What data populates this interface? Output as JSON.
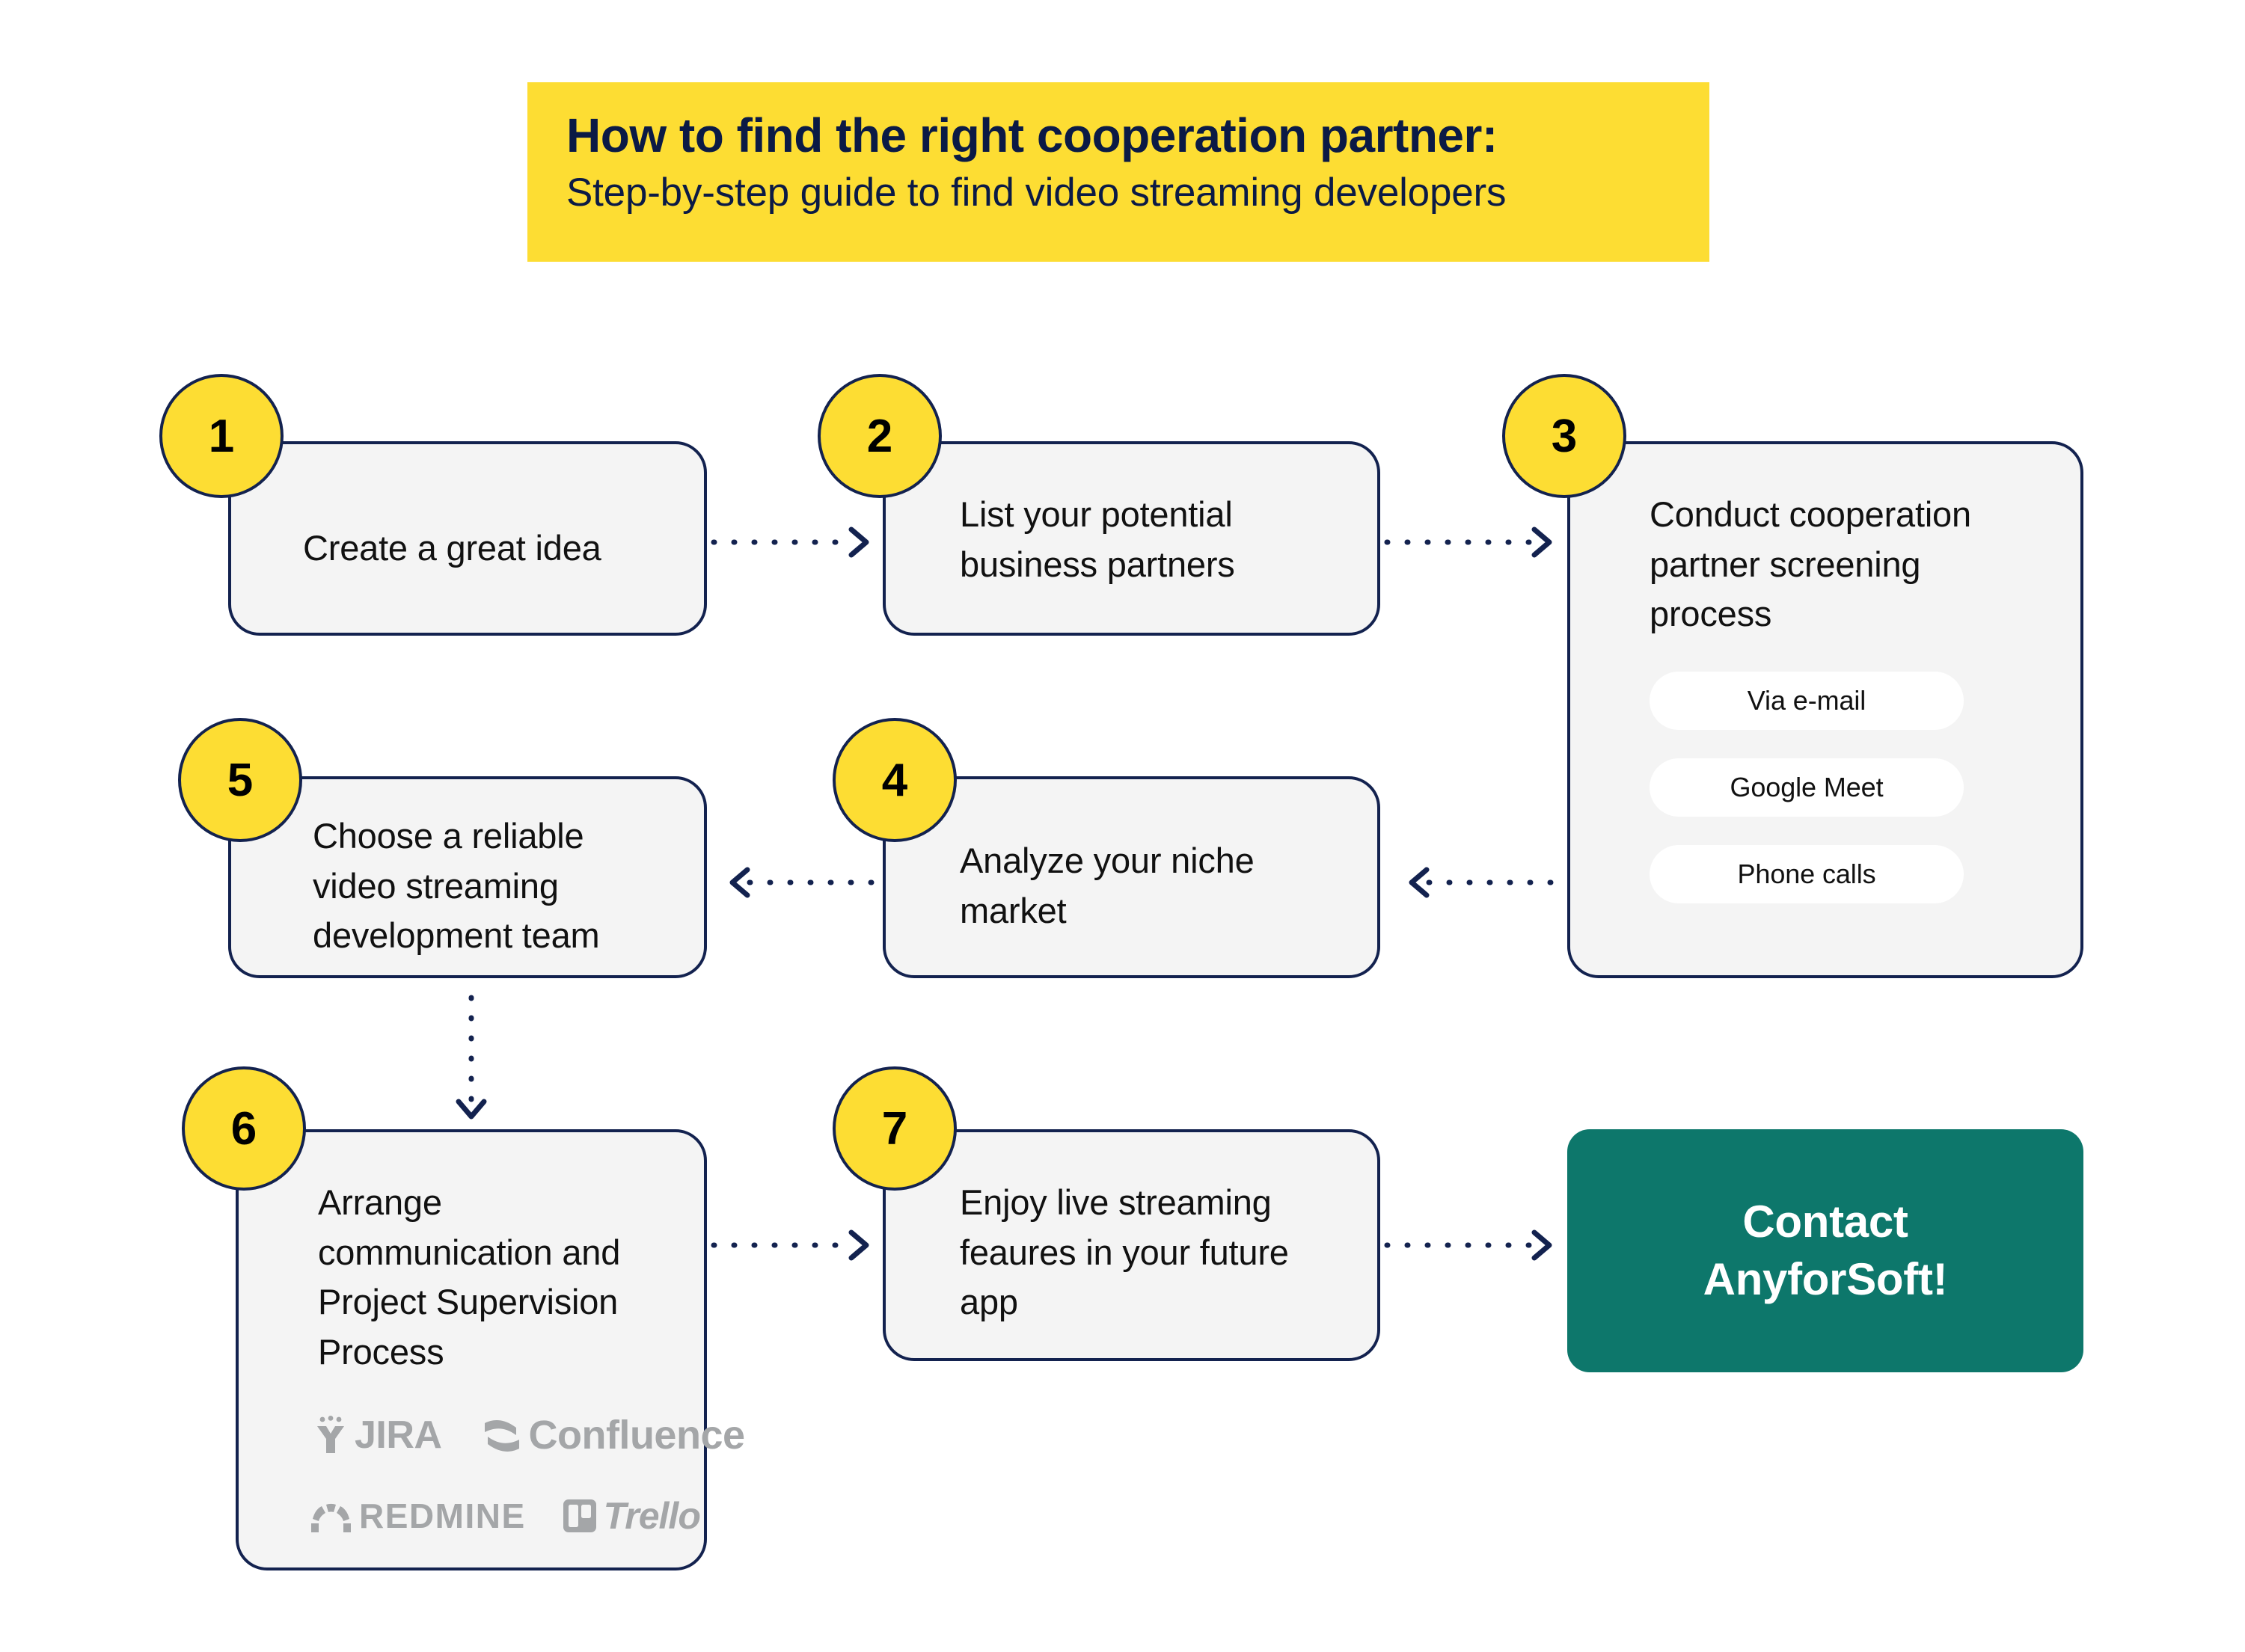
{
  "title": {
    "main": "How to find the right cooperation partner:",
    "sub": "Step-by-step guide to find video streaming developers"
  },
  "colors": {
    "yellow": "#FDDD33",
    "navy": "#13224F",
    "title_navy": "#0B1A45",
    "box_bg": "#F4F4F4",
    "teal": "#0D776B",
    "logo_grey": "#A4A6A8",
    "pill_bg": "#FFFFFF",
    "page_bg": "#FFFFFF"
  },
  "steps": [
    {
      "number": "1",
      "text": "Create a great idea"
    },
    {
      "number": "2",
      "text": "List your potential business partners"
    },
    {
      "number": "3",
      "text": "Conduct cooperation partner screening process"
    },
    {
      "number": "4",
      "text": "Analyze your niche market"
    },
    {
      "number": "5",
      "text": "Choose a reliable video streaming development team"
    },
    {
      "number": "6",
      "text": "Arrange communication and Project Supervision Process"
    },
    {
      "number": "7",
      "text": "Enjoy live streaming feaures in your future app"
    }
  ],
  "step3_options": [
    {
      "label": "Via e-mail"
    },
    {
      "label": "Google Meet"
    },
    {
      "label": "Phone calls"
    }
  ],
  "step6_tools": [
    {
      "name": "JIRA"
    },
    {
      "name": "Confluence"
    },
    {
      "name": "REDMINE"
    },
    {
      "name": "Trello"
    }
  ],
  "cta": {
    "line1": "Contact",
    "line2": "AnyforSoft!"
  },
  "arrows": [
    {
      "id": "a1",
      "from": "step-1",
      "to": "step-2",
      "direction": "right"
    },
    {
      "id": "a2",
      "from": "step-2",
      "to": "step-3",
      "direction": "right"
    },
    {
      "id": "a3",
      "from": "step-3",
      "to": "step-4",
      "direction": "left"
    },
    {
      "id": "a4",
      "from": "step-4",
      "to": "step-5",
      "direction": "left"
    },
    {
      "id": "a5",
      "from": "step-5",
      "to": "step-6",
      "direction": "down"
    },
    {
      "id": "a6",
      "from": "step-6",
      "to": "step-7",
      "direction": "right"
    },
    {
      "id": "a7",
      "from": "step-7",
      "to": "cta",
      "direction": "right"
    }
  ]
}
